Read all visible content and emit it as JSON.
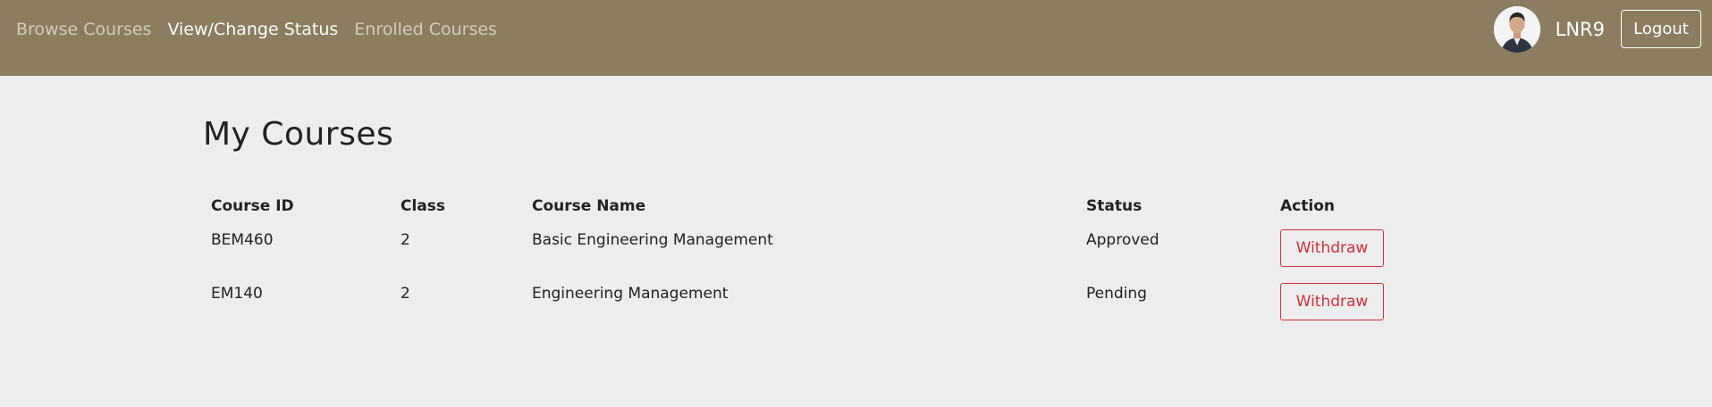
{
  "nav": {
    "links": [
      {
        "label": "Browse Courses",
        "active": false
      },
      {
        "label": "View/Change Status",
        "active": true
      },
      {
        "label": "Enrolled Courses",
        "active": false
      }
    ],
    "username": "LNR9",
    "logout_label": "Logout",
    "avatar_icon": "user-avatar-photo"
  },
  "main": {
    "title": "My Courses",
    "table": {
      "headers": [
        "Course ID",
        "Class",
        "Course Name",
        "Status",
        "Action"
      ],
      "rows": [
        {
          "course_id": "BEM460",
          "class": "2",
          "course_name": "Basic Engineering Management",
          "status": "Approved",
          "action": "Withdraw"
        },
        {
          "course_id": "EM140",
          "class": "2",
          "course_name": "Engineering Management",
          "status": "Pending",
          "action": "Withdraw"
        }
      ]
    }
  },
  "colors": {
    "navbar": "#8c7d60",
    "background": "#ededed",
    "danger": "#d3303f",
    "muted": "#76777b"
  }
}
